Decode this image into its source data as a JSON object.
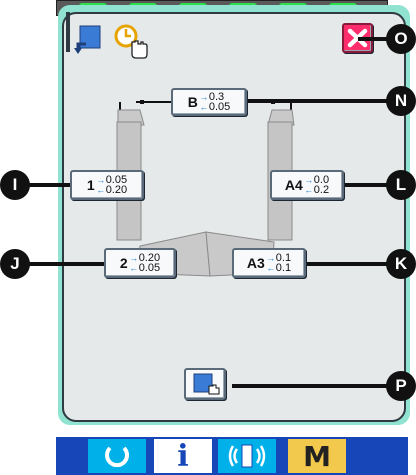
{
  "header": {
    "return_icon": "page-return-icon",
    "clock_icon": "clock-touch-icon",
    "close_icon": "close-x-icon",
    "close_color": "#ff2d6b"
  },
  "callouts": {
    "top_right": "O",
    "top_center": "N",
    "left_mid": "I",
    "right_mid": "L",
    "left_lower": "J",
    "right_lower": "K",
    "bottom": "P"
  },
  "buttons": {
    "B": {
      "label": "B",
      "v1": "0.3",
      "v2": "0.05"
    },
    "1": {
      "label": "1",
      "v1": "0.05",
      "v2": "0.20"
    },
    "A4": {
      "label": "A4",
      "v1": "0.0",
      "v2": "0.2"
    },
    "2": {
      "label": "2",
      "v1": "0.20",
      "v2": "0.05"
    },
    "A3": {
      "label": "A3",
      "v1": "0.1",
      "v2": "0.1"
    }
  },
  "taskbar": {
    "reset_icon": "reset-circle-icon",
    "info_icon": "info-icon",
    "info_label": "i",
    "comm_icon": "communication-icon",
    "mode_label": "M",
    "colors": {
      "bar": "#1746b8",
      "cyan": "#00b0e8",
      "white": "#ffffff",
      "mode": "#f2c94c"
    }
  }
}
